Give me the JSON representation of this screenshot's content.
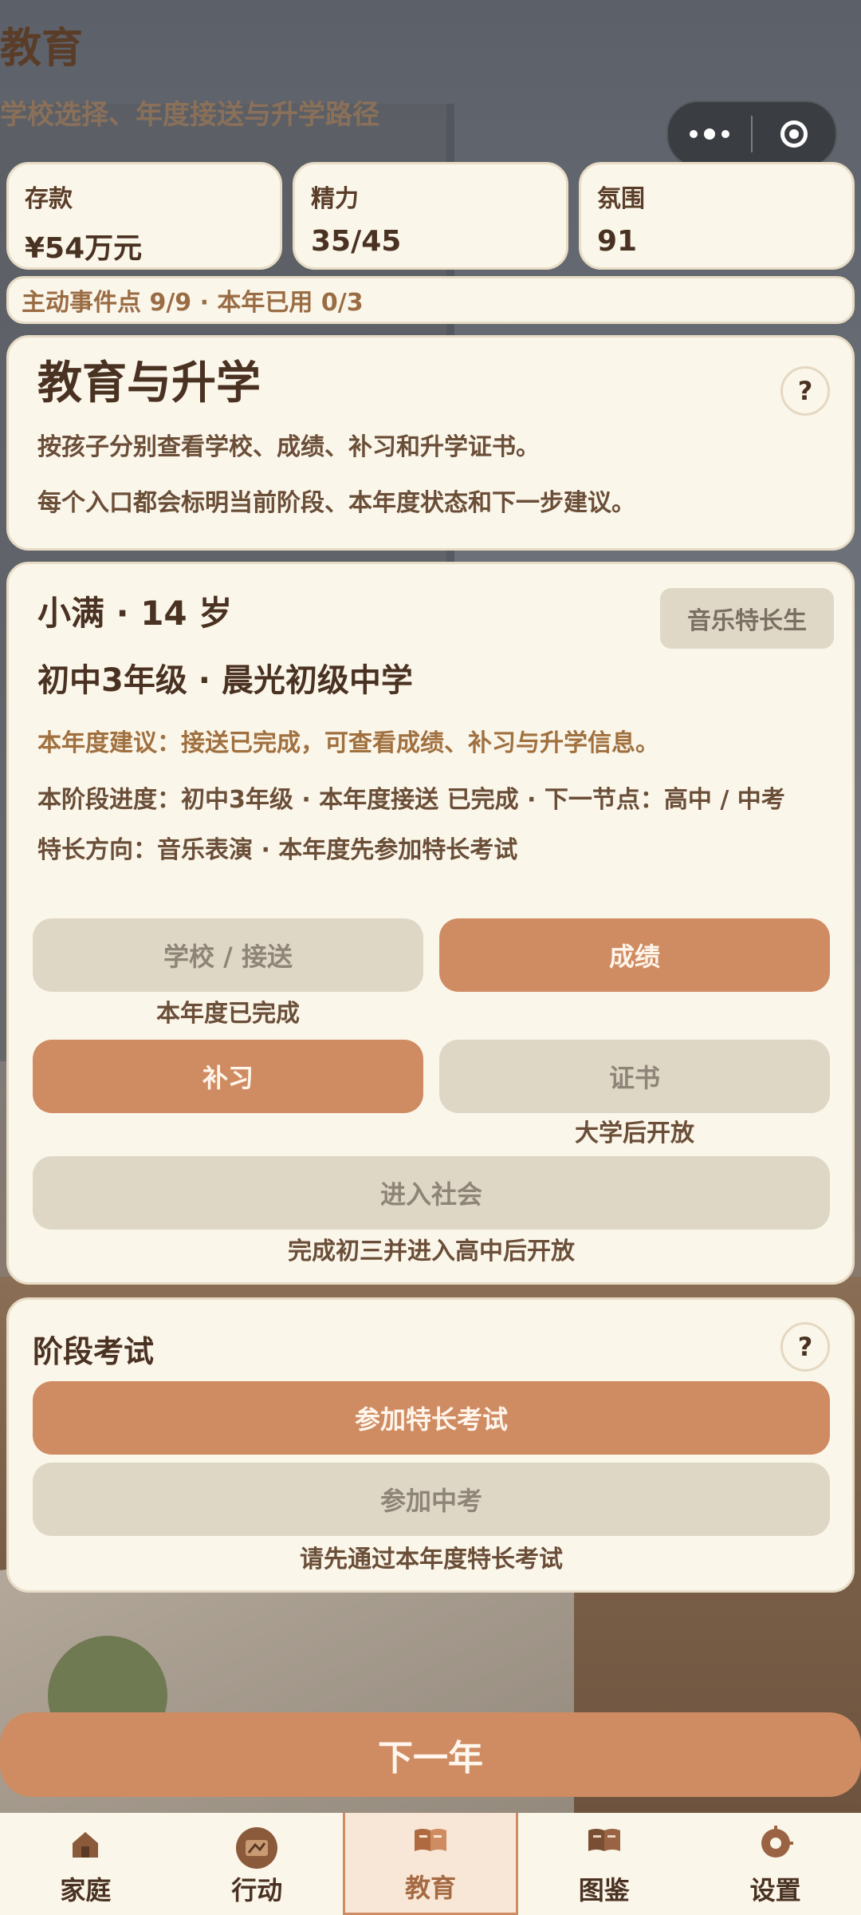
{
  "header": {
    "title": "教育",
    "subtitle": "学校选择、年度接送与升学路径"
  },
  "stats": [
    {
      "label": "存款",
      "value": "¥54万元"
    },
    {
      "label": "精力",
      "value": "35/45"
    },
    {
      "label": "氛围",
      "value": "91"
    }
  ],
  "events_line": "主动事件点 9/9 · 本年已用 0/3",
  "intro": {
    "title": "教育与升学",
    "line1": "按孩子分别查看学校、成绩、补习和升学证书。",
    "line2": "每个入口都会标明当前阶段、本年度状态和下一步建议。",
    "help": "?"
  },
  "child": {
    "name": "小满 · 14 岁",
    "grade": "初中3年级 · 晨光初级中学",
    "tag": "音乐特长生",
    "advice": "本年度建议：接送已完成，可查看成绩、补习与升学信息。",
    "progress": "本阶段进度：初中3年级 · 本年度接送 已完成 · 下一节点：高中 / 中考",
    "talent": "特长方向：音乐表演 · 本年度先参加特长考试",
    "buttons": {
      "school": "学校 / 接送",
      "school_note": "本年度已完成",
      "grades": "成绩",
      "tutoring": "补习",
      "certificate": "证书",
      "certificate_note": "大学后开放",
      "society": "进入社会",
      "society_note": "完成初三并进入高中后开放"
    }
  },
  "exam": {
    "title": "阶段考试",
    "help": "?",
    "talent_exam": "参加特长考试",
    "zhongkao": "参加中考",
    "zhongkao_note": "请先通过本年度特长考试"
  },
  "next_year": "下一年",
  "tabbar": [
    {
      "label": "家庭",
      "icon": "house-icon"
    },
    {
      "label": "行动",
      "icon": "action-icon"
    },
    {
      "label": "教育",
      "icon": "book-icon",
      "active": true
    },
    {
      "label": "图鉴",
      "icon": "book-icon"
    },
    {
      "label": "设置",
      "icon": "gear-icon"
    }
  ],
  "colors": {
    "accent": "#cf8c63",
    "card_bg": "#fbf6ea",
    "disabled_bg": "#dfd7c5",
    "text_dark": "#4a3222",
    "advice_text": "#a0703f"
  }
}
